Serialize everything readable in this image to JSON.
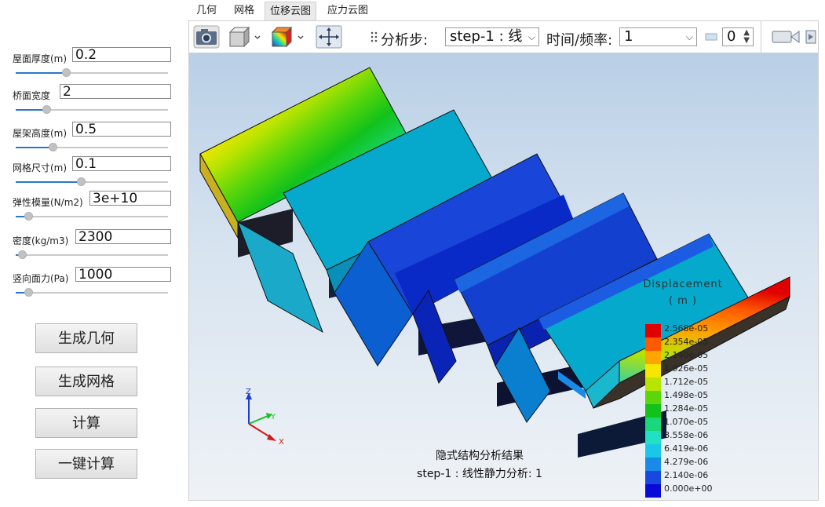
{
  "params": [
    {
      "label": "屋面厚度(m)",
      "value": "0.2",
      "slider": 0.33
    },
    {
      "label": "桥面宽度",
      "value": "2",
      "slider": 0.2
    },
    {
      "label": "屋架高度(m)",
      "value": "0.5",
      "slider": 0.24
    },
    {
      "label": "网格尺寸(m)",
      "value": "0.1",
      "slider": 0.43
    },
    {
      "label": "弹性模量(N/m2)",
      "value": "3e+10",
      "slider": 0.08
    },
    {
      "label": "密度(kg/m3)",
      "value": "2300",
      "slider": 0.04
    },
    {
      "label": "竖向面力(Pa)",
      "value": "1000",
      "slider": 0.08
    }
  ],
  "buttons": [
    "生成几何",
    "生成网格",
    "计算",
    "一键计算"
  ],
  "tabs": [
    "几何",
    "网格",
    "位移云图",
    "应力云图"
  ],
  "active_tab": "位移云图",
  "toolbar": {
    "step_label": "分析步:",
    "step_value": "step-1 : 线",
    "time_label": "时间/频率:",
    "time_value": "1",
    "frame_value": "0"
  },
  "legend": {
    "title": "Displacement",
    "unit": "( m )",
    "labels": [
      "2.568e-05",
      "2.354e-05",
      "2.140e-05",
      "1.926e-05",
      "1.712e-05",
      "1.498e-05",
      "1.284e-05",
      "1.070e-05",
      "8.558e-06",
      "6.419e-06",
      "4.279e-06",
      "2.140e-06",
      "0.000e+00"
    ],
    "colors": [
      "#e00000",
      "#ff5a00",
      "#ffa500",
      "#f7e600",
      "#b8e400",
      "#5ad60a",
      "#12c21a",
      "#19d77a",
      "#22e0c4",
      "#19c8e6",
      "#1a8ae8",
      "#1848e0",
      "#0a0ad8"
    ]
  },
  "axes": {
    "z": "Z",
    "y": "Y",
    "x": "X"
  },
  "caption": {
    "line1": "隐式结构分析结果",
    "line2": "step-1 : 线性静力分析: 1"
  }
}
